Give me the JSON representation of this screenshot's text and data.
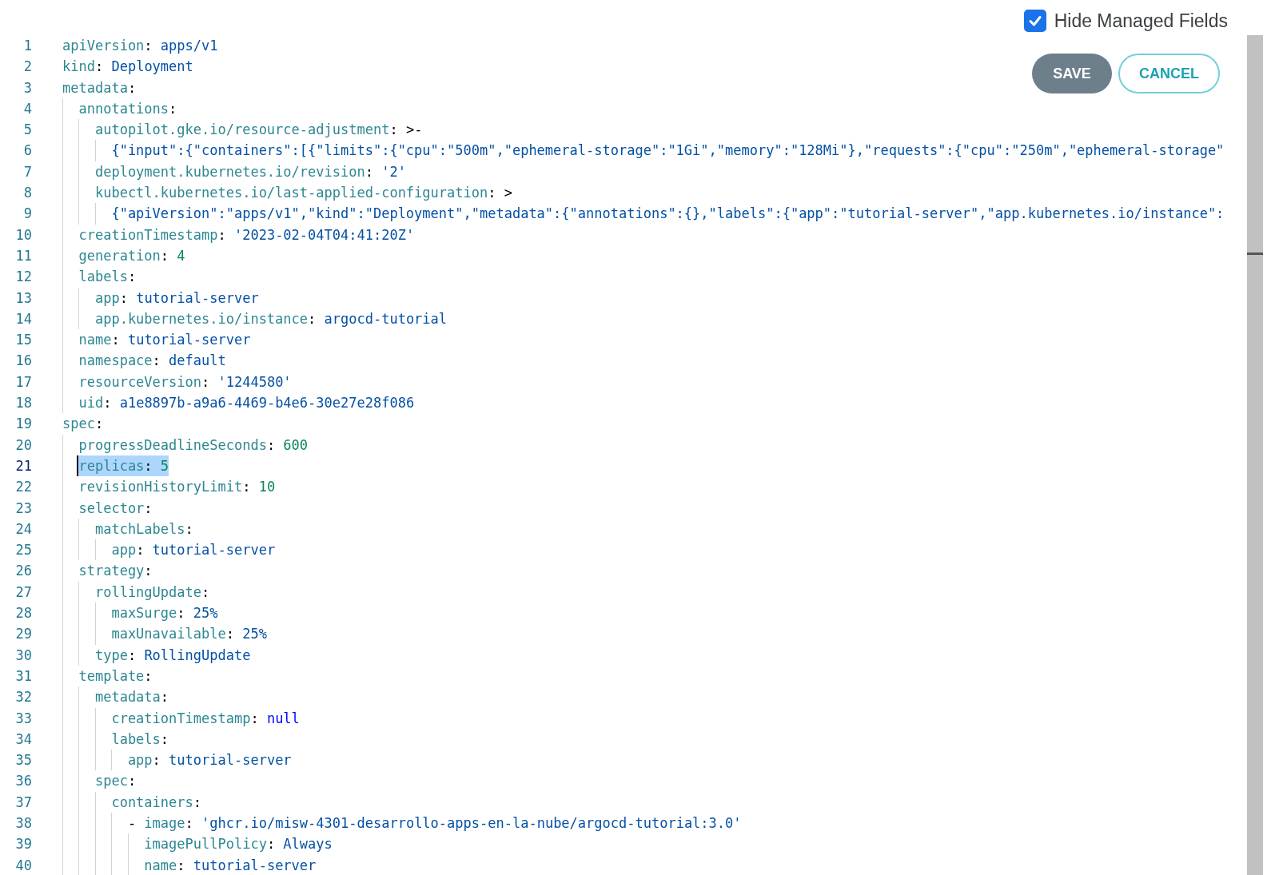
{
  "hide_managed_fields": {
    "label": "Hide Managed Fields",
    "checked": true
  },
  "buttons": [
    {
      "label": "SAVE",
      "kind": "primary"
    },
    {
      "label": "CANCEL",
      "kind": "outline"
    }
  ],
  "editor": {
    "lines": [
      {
        "num": "1",
        "selected": false,
        "parts": [
          {
            "kind": "key",
            "text": "apiVersion"
          },
          {
            "kind": "punct",
            "text": ": "
          },
          {
            "kind": "string",
            "text": "apps/v1"
          }
        ]
      },
      {
        "num": "2",
        "selected": false,
        "parts": [
          {
            "kind": "key",
            "text": "kind"
          },
          {
            "kind": "punct",
            "text": ": "
          },
          {
            "kind": "string",
            "text": "Deployment"
          }
        ]
      },
      {
        "num": "3",
        "selected": false,
        "parts": [
          {
            "kind": "key",
            "text": "metadata"
          },
          {
            "kind": "punct",
            "text": ":"
          }
        ],
        "children": [
          {
            "num": "4",
            "selected": false,
            "parts": [
              {
                "kind": "key",
                "text": "annotations"
              },
              {
                "kind": "punct",
                "text": ":"
              }
            ],
            "children": [
              {
                "num": "5",
                "selected": false,
                "parts": [
                  {
                    "kind": "key",
                    "text": "autopilot.gke.io/resource-adjustment"
                  },
                  {
                    "kind": "punct",
                    "text": ": "
                  },
                  {
                    "kind": "indicator",
                    "text": ">-"
                  }
                ],
                "children": [
                  {
                    "num": "6",
                    "selected": false,
                    "parts": [
                      {
                        "kind": "string",
                        "text": "{\"input\":{\"containers\":[{\"limits\":{\"cpu\":\"500m\",\"ephemeral-storage\":\"1Gi\",\"memory\":\"128Mi\"},\"requests\":{\"cpu\":\"250m\",\"ephemeral-storage\""
                      }
                    ]
                  }
                ]
              },
              {
                "num": "7",
                "selected": false,
                "parts": [
                  {
                    "kind": "key",
                    "text": "deployment.kubernetes.io/revision"
                  },
                  {
                    "kind": "punct",
                    "text": ": "
                  },
                  {
                    "kind": "string",
                    "text": "'2'"
                  }
                ]
              },
              {
                "num": "8",
                "selected": false,
                "parts": [
                  {
                    "kind": "key",
                    "text": "kubectl.kubernetes.io/last-applied-configuration"
                  },
                  {
                    "kind": "punct",
                    "text": ": "
                  },
                  {
                    "kind": "indicator",
                    "text": ">"
                  }
                ],
                "children": [
                  {
                    "num": "9",
                    "selected": false,
                    "parts": [
                      {
                        "kind": "string",
                        "text": "{\"apiVersion\":\"apps/v1\",\"kind\":\"Deployment\",\"metadata\":{\"annotations\":{},\"labels\":{\"app\":\"tutorial-server\",\"app.kubernetes.io/instance\":"
                      }
                    ]
                  }
                ]
              }
            ]
          },
          {
            "num": "10",
            "selected": false,
            "parts": [
              {
                "kind": "key",
                "text": "creationTimestamp"
              },
              {
                "kind": "punct",
                "text": ": "
              },
              {
                "kind": "string",
                "text": "'2023-02-04T04:41:20Z'"
              }
            ]
          },
          {
            "num": "11",
            "selected": false,
            "parts": [
              {
                "kind": "key",
                "text": "generation"
              },
              {
                "kind": "punct",
                "text": ": "
              },
              {
                "kind": "number",
                "text": "4"
              }
            ]
          },
          {
            "num": "12",
            "selected": false,
            "parts": [
              {
                "kind": "key",
                "text": "labels"
              },
              {
                "kind": "punct",
                "text": ":"
              }
            ],
            "children": [
              {
                "num": "13",
                "selected": false,
                "parts": [
                  {
                    "kind": "key",
                    "text": "app"
                  },
                  {
                    "kind": "punct",
                    "text": ": "
                  },
                  {
                    "kind": "string",
                    "text": "tutorial-server"
                  }
                ]
              },
              {
                "num": "14",
                "selected": false,
                "parts": [
                  {
                    "kind": "key",
                    "text": "app.kubernetes.io/instance"
                  },
                  {
                    "kind": "punct",
                    "text": ": "
                  },
                  {
                    "kind": "string",
                    "text": "argocd-tutorial"
                  }
                ]
              }
            ]
          },
          {
            "num": "15",
            "selected": false,
            "parts": [
              {
                "kind": "key",
                "text": "name"
              },
              {
                "kind": "punct",
                "text": ": "
              },
              {
                "kind": "string",
                "text": "tutorial-server"
              }
            ]
          },
          {
            "num": "16",
            "selected": false,
            "parts": [
              {
                "kind": "key",
                "text": "namespace"
              },
              {
                "kind": "punct",
                "text": ": "
              },
              {
                "kind": "string",
                "text": "default"
              }
            ]
          },
          {
            "num": "17",
            "selected": false,
            "parts": [
              {
                "kind": "key",
                "text": "resourceVersion"
              },
              {
                "kind": "punct",
                "text": ": "
              },
              {
                "kind": "string",
                "text": "'1244580'"
              }
            ]
          },
          {
            "num": "18",
            "selected": false,
            "parts": [
              {
                "kind": "key",
                "text": "uid"
              },
              {
                "kind": "punct",
                "text": ": "
              },
              {
                "kind": "string",
                "text": "a1e8897b-a9a6-4469-b4e6-30e27e28f086"
              }
            ]
          }
        ]
      },
      {
        "num": "19",
        "selected": false,
        "parts": [
          {
            "kind": "key",
            "text": "spec"
          },
          {
            "kind": "punct",
            "text": ":"
          }
        ],
        "children": [
          {
            "num": "20",
            "selected": false,
            "parts": [
              {
                "kind": "key",
                "text": "progressDeadlineSeconds"
              },
              {
                "kind": "punct",
                "text": ": "
              },
              {
                "kind": "number",
                "text": "600"
              }
            ]
          },
          {
            "num": "21",
            "selected": true,
            "parts": [
              {
                "kind": "key",
                "text": "replicas"
              },
              {
                "kind": "punct",
                "text": ": "
              },
              {
                "kind": "number",
                "text": "5"
              }
            ]
          },
          {
            "num": "22",
            "selected": false,
            "parts": [
              {
                "kind": "key",
                "text": "revisionHistoryLimit"
              },
              {
                "kind": "punct",
                "text": ": "
              },
              {
                "kind": "number",
                "text": "10"
              }
            ]
          },
          {
            "num": "23",
            "selected": false,
            "parts": [
              {
                "kind": "key",
                "text": "selector"
              },
              {
                "kind": "punct",
                "text": ":"
              }
            ],
            "children": [
              {
                "num": "24",
                "selected": false,
                "parts": [
                  {
                    "kind": "key",
                    "text": "matchLabels"
                  },
                  {
                    "kind": "punct",
                    "text": ":"
                  }
                ],
                "children": [
                  {
                    "num": "25",
                    "selected": false,
                    "parts": [
                      {
                        "kind": "key",
                        "text": "app"
                      },
                      {
                        "kind": "punct",
                        "text": ": "
                      },
                      {
                        "kind": "string",
                        "text": "tutorial-server"
                      }
                    ]
                  }
                ]
              }
            ]
          },
          {
            "num": "26",
            "selected": false,
            "parts": [
              {
                "kind": "key",
                "text": "strategy"
              },
              {
                "kind": "punct",
                "text": ":"
              }
            ],
            "children": [
              {
                "num": "27",
                "selected": false,
                "parts": [
                  {
                    "kind": "key",
                    "text": "rollingUpdate"
                  },
                  {
                    "kind": "punct",
                    "text": ":"
                  }
                ],
                "children": [
                  {
                    "num": "28",
                    "selected": false,
                    "parts": [
                      {
                        "kind": "key",
                        "text": "maxSurge"
                      },
                      {
                        "kind": "punct",
                        "text": ": "
                      },
                      {
                        "kind": "string",
                        "text": "25%"
                      }
                    ]
                  },
                  {
                    "num": "29",
                    "selected": false,
                    "parts": [
                      {
                        "kind": "key",
                        "text": "maxUnavailable"
                      },
                      {
                        "kind": "punct",
                        "text": ": "
                      },
                      {
                        "kind": "string",
                        "text": "25%"
                      }
                    ]
                  }
                ]
              },
              {
                "num": "30",
                "selected": false,
                "parts": [
                  {
                    "kind": "key",
                    "text": "type"
                  },
                  {
                    "kind": "punct",
                    "text": ": "
                  },
                  {
                    "kind": "string",
                    "text": "RollingUpdate"
                  }
                ]
              }
            ]
          },
          {
            "num": "31",
            "selected": false,
            "parts": [
              {
                "kind": "key",
                "text": "template"
              },
              {
                "kind": "punct",
                "text": ":"
              }
            ],
            "children": [
              {
                "num": "32",
                "selected": false,
                "parts": [
                  {
                    "kind": "key",
                    "text": "metadata"
                  },
                  {
                    "kind": "punct",
                    "text": ":"
                  }
                ],
                "children": [
                  {
                    "num": "33",
                    "selected": false,
                    "parts": [
                      {
                        "kind": "key",
                        "text": "creationTimestamp"
                      },
                      {
                        "kind": "punct",
                        "text": ": "
                      },
                      {
                        "kind": "null",
                        "text": "null"
                      }
                    ]
                  },
                  {
                    "num": "34",
                    "selected": false,
                    "parts": [
                      {
                        "kind": "key",
                        "text": "labels"
                      },
                      {
                        "kind": "punct",
                        "text": ":"
                      }
                    ],
                    "children": [
                      {
                        "num": "35",
                        "selected": false,
                        "parts": [
                          {
                            "kind": "key",
                            "text": "app"
                          },
                          {
                            "kind": "punct",
                            "text": ": "
                          },
                          {
                            "kind": "string",
                            "text": "tutorial-server"
                          }
                        ]
                      }
                    ]
                  }
                ]
              },
              {
                "num": "36",
                "selected": false,
                "parts": [
                  {
                    "kind": "key",
                    "text": "spec"
                  },
                  {
                    "kind": "punct",
                    "text": ":"
                  }
                ],
                "children": [
                  {
                    "num": "37",
                    "selected": false,
                    "parts": [
                      {
                        "kind": "key",
                        "text": "containers"
                      },
                      {
                        "kind": "punct",
                        "text": ":"
                      }
                    ],
                    "children": [
                      {
                        "num": "38",
                        "selected": false,
                        "parts": [
                          {
                            "kind": "punct",
                            "text": "- "
                          },
                          {
                            "kind": "key",
                            "text": "image"
                          },
                          {
                            "kind": "punct",
                            "text": ": "
                          },
                          {
                            "kind": "string",
                            "text": "'ghcr.io/misw-4301-desarrollo-apps-en-la-nube/argocd-tutorial:3.0'"
                          }
                        ],
                        "children": [
                          {
                            "num": "39",
                            "selected": false,
                            "parts": [
                              {
                                "kind": "key",
                                "text": "imagePullPolicy"
                              },
                              {
                                "kind": "punct",
                                "text": ": "
                              },
                              {
                                "kind": "string",
                                "text": "Always"
                              }
                            ]
                          },
                          {
                            "num": "40",
                            "selected": false,
                            "parts": [
                              {
                                "kind": "key",
                                "text": "name"
                              },
                              {
                                "kind": "punct",
                                "text": ": "
                              },
                              {
                                "kind": "string",
                                "text": "tutorial-server"
                              }
                            ]
                          }
                        ]
                      }
                    ]
                  }
                ]
              }
            ]
          }
        ]
      }
    ]
  }
}
